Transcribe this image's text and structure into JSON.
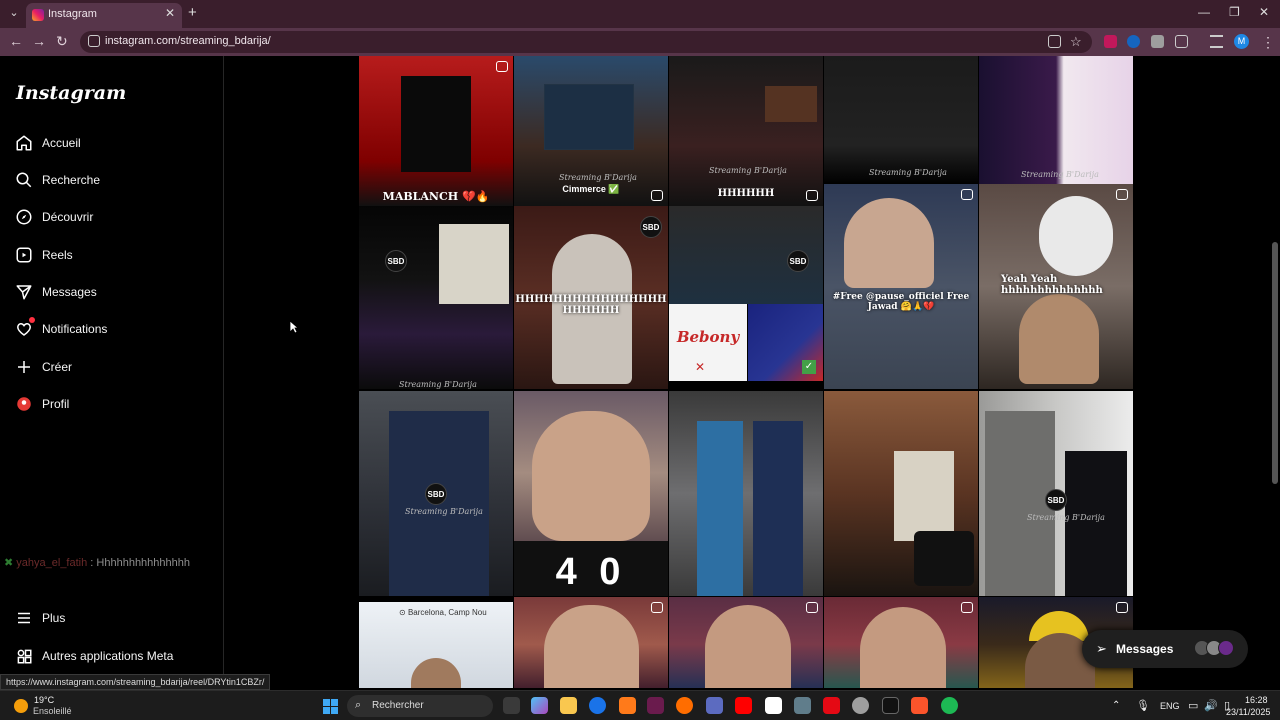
{
  "browser": {
    "tab_title": "Instagram",
    "url": "instagram.com/streaming_bdarija/",
    "status_url": "https://www.instagram.com/streaming_bdarija/reel/DRYtin1CBZr/"
  },
  "sidebar": {
    "logo": "Instagram",
    "items": [
      {
        "label": "Accueil",
        "icon": "home-icon"
      },
      {
        "label": "Recherche",
        "icon": "search-icon"
      },
      {
        "label": "Découvrir",
        "icon": "compass-icon"
      },
      {
        "label": "Reels",
        "icon": "reels-icon"
      },
      {
        "label": "Messages",
        "icon": "send-icon"
      },
      {
        "label": "Notifications",
        "icon": "heart-icon"
      },
      {
        "label": "Créer",
        "icon": "plus-icon"
      },
      {
        "label": "Profil",
        "icon": "profile-avatar"
      }
    ],
    "more_label": "Plus",
    "meta_label": "Autres applications Meta"
  },
  "chat_overlay": {
    "user": "yahya_el_fatih",
    "message": ": Hhhhhhhhhhhhhhh"
  },
  "grid": {
    "posts": [
      {
        "caption": "MABLANCH 💔🔥"
      },
      {
        "caption": "Cimmerce ✅",
        "watermark": "Streaming B'Darija"
      },
      {
        "caption": "HHHHHH",
        "watermark": "Streaming B'Darija"
      },
      {
        "caption": "",
        "watermark": "Streaming B'Darija"
      },
      {
        "caption": "",
        "watermark": "Streaming B'Darija"
      },
      {
        "caption": "",
        "badge": "SBD",
        "watermark": "Streaming B'Darija"
      },
      {
        "caption": "HHHHHHHHHHHHHHHH HHHHHH"
      },
      {
        "caption": "",
        "logo_text": "Bebony"
      },
      {
        "caption": "#Free @pause_officiel Free Jawad 🤗🙏💔"
      },
      {
        "caption": "Yeah Yeah hhhhhhhhhhhhhh"
      },
      {
        "caption": "",
        "badge": "SBD",
        "watermark": "Streaming B'Darija"
      },
      {
        "caption": "",
        "score": "4 0"
      },
      {
        "caption": ""
      },
      {
        "caption": ""
      },
      {
        "caption": "",
        "badge": "SBD",
        "watermark": "Streaming B'Darija"
      },
      {
        "caption": "",
        "location": "Barcelona, Camp Nou"
      },
      {
        "caption": ""
      },
      {
        "caption": ""
      },
      {
        "caption": ""
      },
      {
        "caption": ""
      }
    ]
  },
  "floating_messages": {
    "label": "Messages"
  },
  "taskbar": {
    "weather_temp": "19°C",
    "weather_desc": "Ensoleillé",
    "search_placeholder": "Rechercher",
    "lang": "ENG",
    "time": "16:28",
    "date": "23/11/2025"
  },
  "colors": {
    "browser_frame": "#3a1e2c",
    "browser_toolbar": "#57354a",
    "page_bg": "#000000",
    "notification_dot": "#ff3040"
  }
}
